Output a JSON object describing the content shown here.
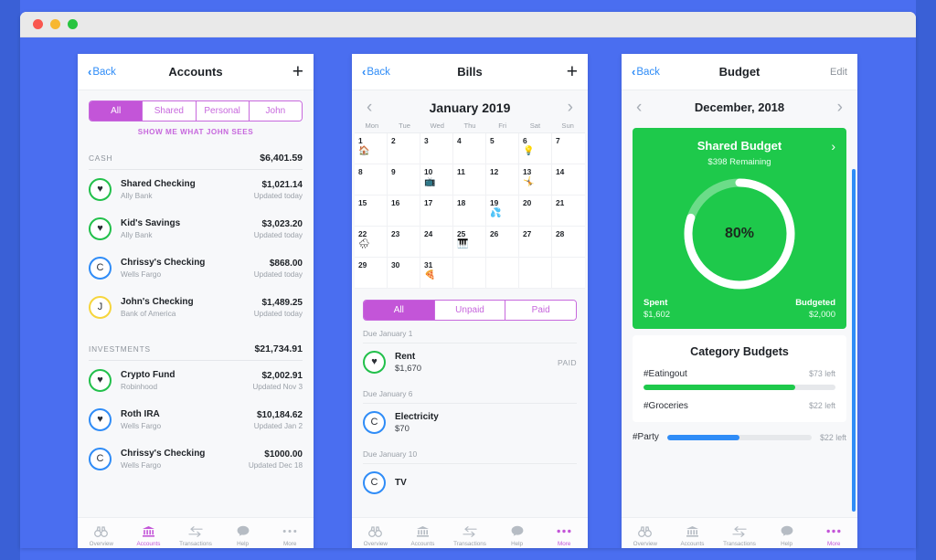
{
  "window": {
    "dots": [
      "close",
      "minimize",
      "maximize"
    ]
  },
  "accounts_panel": {
    "nav": {
      "back": "Back",
      "title": "Accounts",
      "add": "+"
    },
    "segments": [
      {
        "label": "All",
        "active": true
      },
      {
        "label": "Shared",
        "active": false
      },
      {
        "label": "Personal",
        "active": false
      },
      {
        "label": "John",
        "active": false
      }
    ],
    "note": "SHOW ME WHAT JOHN SEES",
    "sections": [
      {
        "title": "CASH",
        "total": "$6,401.59",
        "rows": [
          {
            "glyph": "♥",
            "ring": "green",
            "name": "Shared Checking",
            "sub": "Ally Bank",
            "amount": "$1,021.14",
            "updated": "Updated today"
          },
          {
            "glyph": "♥",
            "ring": "green",
            "name": "Kid's Savings",
            "sub": "Ally Bank",
            "amount": "$3,023.20",
            "updated": "Updated today"
          },
          {
            "glyph": "C",
            "ring": "blue",
            "name": "Chrissy's Checking",
            "sub": "Wells Fargo",
            "amount": "$868.00",
            "updated": "Updated today"
          },
          {
            "glyph": "J",
            "ring": "yellow",
            "name": "John's Checking",
            "sub": "Bank of America",
            "amount": "$1,489.25",
            "updated": "Updated today"
          }
        ]
      },
      {
        "title": "INVESTMENTS",
        "total": "$21,734.91",
        "rows": [
          {
            "glyph": "♥",
            "ring": "green",
            "name": "Crypto Fund",
            "sub": "Robinhood",
            "amount": "$2,002.91",
            "updated": "Updated Nov 3"
          },
          {
            "glyph": "♥",
            "ring": "blue",
            "name": "Roth IRA",
            "sub": "Wells Fargo",
            "amount": "$10,184.62",
            "updated": "Updated Jan 2"
          },
          {
            "glyph": "C",
            "ring": "blue",
            "name": "Chrissy's Checking",
            "sub": "Wells Fargo",
            "amount": "$1000.00",
            "updated": "Updated Dec 18"
          }
        ]
      }
    ],
    "tabs": [
      {
        "label": "Overview",
        "icon": "binoculars-icon",
        "active": false
      },
      {
        "label": "Accounts",
        "icon": "bank-icon",
        "active": true
      },
      {
        "label": "Transactions",
        "icon": "transfer-arrows-icon",
        "active": false
      },
      {
        "label": "Help",
        "icon": "chat-bubble-icon",
        "active": false
      },
      {
        "label": "More",
        "icon": "ellipsis-icon",
        "active": false
      }
    ]
  },
  "bills_panel": {
    "nav": {
      "back": "Back",
      "title": "Bills",
      "add": "+"
    },
    "calendar": {
      "month": "January 2019",
      "prev": "‹",
      "next": "›",
      "dow": [
        "Mon",
        "Tue",
        "Wed",
        "Thu",
        "Fri",
        "Sat",
        "Sun"
      ],
      "days": [
        {
          "n": "1",
          "emoji": "🏠"
        },
        {
          "n": "2"
        },
        {
          "n": "3"
        },
        {
          "n": "4"
        },
        {
          "n": "5"
        },
        {
          "n": "6",
          "emoji": "💡"
        },
        {
          "n": "7"
        },
        {
          "n": "8"
        },
        {
          "n": "9"
        },
        {
          "n": "10",
          "emoji": "📺"
        },
        {
          "n": "11"
        },
        {
          "n": "12"
        },
        {
          "n": "13",
          "emoji": "🤸"
        },
        {
          "n": "14"
        },
        {
          "n": "15"
        },
        {
          "n": "16"
        },
        {
          "n": "17"
        },
        {
          "n": "18"
        },
        {
          "n": "19",
          "emoji": "💦"
        },
        {
          "n": "20"
        },
        {
          "n": "21"
        },
        {
          "n": "22",
          "emoji": "🌧"
        },
        {
          "n": "23"
        },
        {
          "n": "24"
        },
        {
          "n": "25",
          "emoji": "🎹"
        },
        {
          "n": "26"
        },
        {
          "n": "27"
        },
        {
          "n": "28"
        },
        {
          "n": "29"
        },
        {
          "n": "30"
        },
        {
          "n": "31",
          "emoji": "🍕"
        },
        {
          "n": ""
        },
        {
          "n": ""
        },
        {
          "n": ""
        },
        {
          "n": ""
        }
      ]
    },
    "segments": [
      {
        "label": "All",
        "active": true
      },
      {
        "label": "Unpaid",
        "active": false
      },
      {
        "label": "Paid",
        "active": false
      }
    ],
    "groups": [
      {
        "due": "Due January 1",
        "bill": {
          "glyph": "♥",
          "ring": "green",
          "name": "Rent",
          "amount": "$1,670",
          "status": "PAID"
        }
      },
      {
        "due": "Due January 6",
        "bill": {
          "glyph": "C",
          "ring": "blue",
          "name": "Electricity",
          "amount": "$70",
          "status": ""
        }
      },
      {
        "due": "Due January 10",
        "bill": {
          "glyph": "C",
          "ring": "blue",
          "name": "TV",
          "amount": "",
          "status": ""
        }
      }
    ],
    "tabs": [
      {
        "label": "Overview",
        "icon": "binoculars-icon",
        "active": false
      },
      {
        "label": "Accounts",
        "icon": "bank-icon",
        "active": false
      },
      {
        "label": "Transactions",
        "icon": "transfer-arrows-icon",
        "active": false
      },
      {
        "label": "Help",
        "icon": "chat-bubble-icon",
        "active": false
      },
      {
        "label": "More",
        "icon": "ellipsis-icon",
        "active": true
      }
    ]
  },
  "budget_panel": {
    "nav": {
      "back": "Back",
      "title": "Budget",
      "edit": "Edit"
    },
    "month": {
      "label": "December, 2018",
      "prev": "‹",
      "next": "›"
    },
    "shared_budget": {
      "title": "Shared Budget",
      "remaining": "$398 Remaining",
      "chevron": "›",
      "percent_label": "80%",
      "percent_value": 80,
      "spent_label": "Spent",
      "spent_value": "$1,602",
      "budgeted_label": "Budgeted",
      "budgeted_value": "$2,000"
    },
    "categories": {
      "title": "Category Budgets",
      "items": [
        {
          "name": "#Eatingout",
          "left": "$73 left",
          "progress": 79,
          "color": "green"
        },
        {
          "name": "#Groceries",
          "left": "$22 left",
          "progress": 0,
          "color": "green"
        }
      ],
      "party": {
        "name": "#Party",
        "left": "$22 left",
        "progress": 50,
        "color": "blue"
      }
    },
    "tabs": [
      {
        "label": "Overview",
        "icon": "binoculars-icon",
        "active": false
      },
      {
        "label": "Accounts",
        "icon": "bank-icon",
        "active": false
      },
      {
        "label": "Transactions",
        "icon": "transfer-arrows-icon",
        "active": false
      },
      {
        "label": "Help",
        "icon": "chat-bubble-icon",
        "active": false
      },
      {
        "label": "More",
        "icon": "ellipsis-icon",
        "active": true
      }
    ]
  },
  "colors": {
    "background_blue": "#4a6ef0",
    "accent_purple": "#c355d8",
    "green": "#1ec94b",
    "blue": "#2f8cf7",
    "yellow": "#f6d53c"
  }
}
